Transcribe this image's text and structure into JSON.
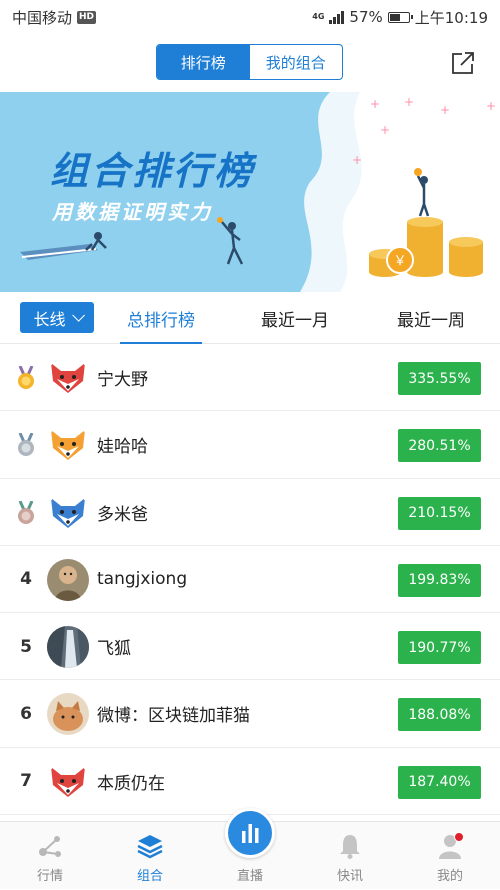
{
  "status_bar": {
    "carrier": "中国移动",
    "hd": "HD",
    "network": "4G",
    "battery": "57%",
    "battery_level": 0.57,
    "time": "上午10:19"
  },
  "header": {
    "tabs": [
      {
        "label": "排行榜",
        "active": true
      },
      {
        "label": "我的组合",
        "active": false
      }
    ],
    "share_icon": "share-icon"
  },
  "banner": {
    "title": "组合排行榜",
    "subtitle": "用数据证明实力"
  },
  "filter": {
    "dropdown_label": "长线",
    "tabs": [
      {
        "label": "总排行榜",
        "active": true
      },
      {
        "label": "最近一月",
        "active": false
      },
      {
        "label": "最近一周",
        "active": false
      }
    ]
  },
  "rankings": [
    {
      "rank": "",
      "medal": "gold",
      "name": "宁大野",
      "return": "335.55%",
      "avatar": "fox-red"
    },
    {
      "rank": "",
      "medal": "silver",
      "name": "娃哈哈",
      "return": "280.51%",
      "avatar": "fox-orange"
    },
    {
      "rank": "",
      "medal": "bronze",
      "name": "多米爸",
      "return": "210.15%",
      "avatar": "fox-blue"
    },
    {
      "rank": "4",
      "medal": "",
      "name": "tangjxiong",
      "return": "199.83%",
      "avatar": "photo-child"
    },
    {
      "rank": "5",
      "medal": "",
      "name": "飞狐",
      "return": "190.77%",
      "avatar": "photo-waterfall"
    },
    {
      "rank": "6",
      "medal": "",
      "name": "微博：区块链加菲猫",
      "return": "188.08%",
      "avatar": "photo-cat"
    },
    {
      "rank": "7",
      "medal": "",
      "name": "本质仍在",
      "return": "187.40%",
      "avatar": "fox-red"
    }
  ],
  "colors": {
    "accent": "#1f7fd6",
    "positive": "#2bb24c",
    "banner_bg": "#8fd0ee"
  },
  "bottom_nav": [
    {
      "label": "行情",
      "icon": "market-icon",
      "active": false
    },
    {
      "label": "组合",
      "icon": "portfolio-layers-icon",
      "active": true
    },
    {
      "label": "直播",
      "icon": "live-chart-icon",
      "active": false
    },
    {
      "label": "快讯",
      "icon": "bell-icon",
      "active": false
    },
    {
      "label": "我的",
      "icon": "user-icon",
      "active": false
    }
  ]
}
